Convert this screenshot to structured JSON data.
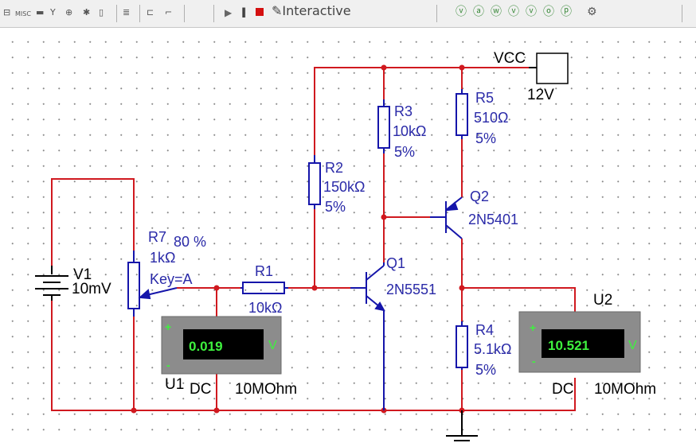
{
  "toolbar": {
    "misc_label": "MISC",
    "interactive_label": "Interactive",
    "icons": [
      "probe-icon",
      "misc-icon",
      "component-icon",
      "antenna-icon",
      "transistor-icon",
      "bus-icon",
      "connector-icon",
      "hierarchy-icon",
      "wire-icon",
      "step-icon",
      "run-icon",
      "pause-icon",
      "stop-icon",
      "interactive-icon",
      "postprocess-icons",
      "gear-icon"
    ]
  },
  "components": {
    "vcc": {
      "name": "VCC",
      "value": "12V"
    },
    "v1": {
      "name": "V1",
      "value": "10mV"
    },
    "r7": {
      "name": "R7",
      "percent": "80 %",
      "value": "1kΩ",
      "key": "Key=A"
    },
    "r1": {
      "name": "R1",
      "value": "10kΩ"
    },
    "r2": {
      "name": "R2",
      "value": "150kΩ",
      "tol": "5%"
    },
    "r3": {
      "name": "R3",
      "value": "10kΩ",
      "tol": "5%"
    },
    "r4": {
      "name": "R4",
      "value": "5.1kΩ",
      "tol": "5%"
    },
    "r5": {
      "name": "R5",
      "value": "510Ω",
      "tol": "5%"
    },
    "q1": {
      "name": "Q1",
      "part": "2N5551"
    },
    "q2": {
      "name": "Q2",
      "part": "2N5401"
    },
    "u1": {
      "name": "U1",
      "reading": "0.019",
      "unit": "V",
      "mode": "DC",
      "impedance": "10MOhm",
      "plus": "+",
      "minus": "-"
    },
    "u2": {
      "name": "U2",
      "reading": "10.521",
      "unit": "V",
      "mode": "DC",
      "impedance": "10MOhm",
      "plus": "+",
      "minus": "-"
    }
  },
  "colors": {
    "wire": "#d0191f",
    "component": "#1515aa",
    "label": "#2a2aa8",
    "meter_body": "#8c8c8c",
    "meter_text": "#3ef23e",
    "meter_unit": "#3ef23e"
  }
}
